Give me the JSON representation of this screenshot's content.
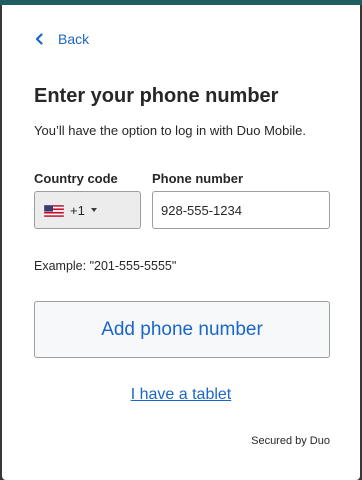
{
  "nav": {
    "back_label": "Back"
  },
  "header": {
    "title": "Enter your phone number",
    "subtitle": "You’ll have the option to log in with Duo Mobile."
  },
  "form": {
    "country_label": "Country code",
    "country_flag_icon": "us-flag-icon",
    "country_dial_code": "+1",
    "phone_label": "Phone number",
    "phone_value": "928-555-1234",
    "example_text": "Example: \"201-555-5555\""
  },
  "actions": {
    "add_button_label": "Add phone number",
    "tablet_link_label": "I have a tablet"
  },
  "footer": {
    "secured_text": "Secured by Duo"
  },
  "colors": {
    "accent": "#1b66c9",
    "top_bar": "#1f5f62",
    "text": "#27272a",
    "background_dark": "#3a3634"
  }
}
